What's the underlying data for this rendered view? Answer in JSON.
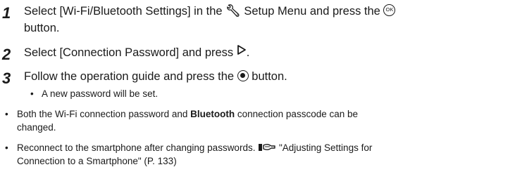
{
  "steps": [
    {
      "number": "1",
      "line1_a": "Select [Wi-Fi/Bluetooth Settings] in the ",
      "line1_b": " Setup Menu and press the ",
      "line2": "button.",
      "icon_setup": "wrench-setup-icon",
      "icon_ok": "ok-button-icon",
      "ok_label": "OK"
    },
    {
      "number": "2",
      "text_a": "Select [Connection Password] and press ",
      "text_b": ".",
      "icon_arrow": "right-arrow-icon"
    },
    {
      "number": "3",
      "text_a": "Follow the operation guide and press the ",
      "text_b": " button.",
      "icon_target": "center-button-icon",
      "sub_bullet": "A new password will be set."
    }
  ],
  "notes": [
    {
      "line1_a": "Both the Wi-Fi connection password and ",
      "line1_bold": "Bluetooth",
      "line1_b": " connection passcode can be",
      "line2": "changed."
    },
    {
      "line1_a": "Reconnect to the smartphone after changing passwords. ",
      "line1_ref": "\"Adjusting Settings for",
      "line2": "Connection to a Smartphone\" (P. 133)",
      "icon_ref": "reference-icon"
    }
  ],
  "bullet_char": "•",
  "colors": {
    "text": "#1a1a1a",
    "background": "#ffffff"
  }
}
